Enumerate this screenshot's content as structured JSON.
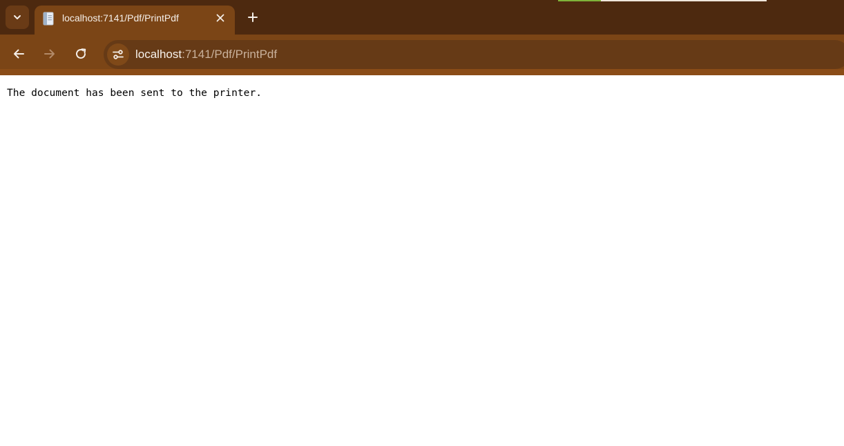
{
  "tabstrip": {
    "tab_search_icon": "chevron-down-icon",
    "tabs": [
      {
        "title": "localhost:7141/Pdf/PrintPdf",
        "favicon": "document-page-icon",
        "close_icon": "close-icon"
      }
    ],
    "new_tab_icon": "plus-icon"
  },
  "toolbar": {
    "back_icon": "arrow-left-icon",
    "forward_icon": "arrow-right-icon",
    "reload_icon": "reload-icon",
    "site_info_icon": "tune-icon",
    "url_host": "localhost",
    "url_rest": ":7141/Pdf/PrintPdf"
  },
  "page": {
    "message": "The document has been sent to the printer."
  },
  "colors": {
    "tabstrip_bg": "#4d290f",
    "toolbar_bg": "#7b4516",
    "omnibox_bg": "#663a16",
    "page_bg": "#ffffff"
  }
}
